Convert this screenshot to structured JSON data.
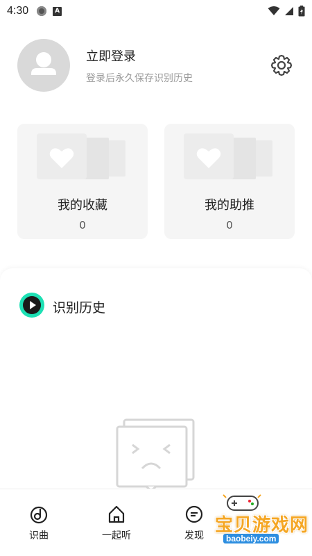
{
  "status_bar": {
    "time": "4:30"
  },
  "profile": {
    "login_title": "立即登录",
    "login_subtitle": "登录后永久保存识别历史"
  },
  "cards": [
    {
      "title": "我的收藏",
      "count": "0"
    },
    {
      "title": "我的助推",
      "count": "0"
    }
  ],
  "history": {
    "title": "识别历史"
  },
  "bottom_nav": {
    "items": [
      {
        "label": "识曲",
        "icon": "music-note-icon"
      },
      {
        "label": "一起听",
        "icon": "home-icon"
      },
      {
        "label": "发现",
        "icon": "discover-icon"
      }
    ]
  },
  "watermark": {
    "text": "宝贝游戏网",
    "sub": "baobeiy.com"
  },
  "colors": {
    "accent": "#1de0b4",
    "card_bg": "#f5f5f5",
    "avatar_bg": "#d9d9d9"
  }
}
